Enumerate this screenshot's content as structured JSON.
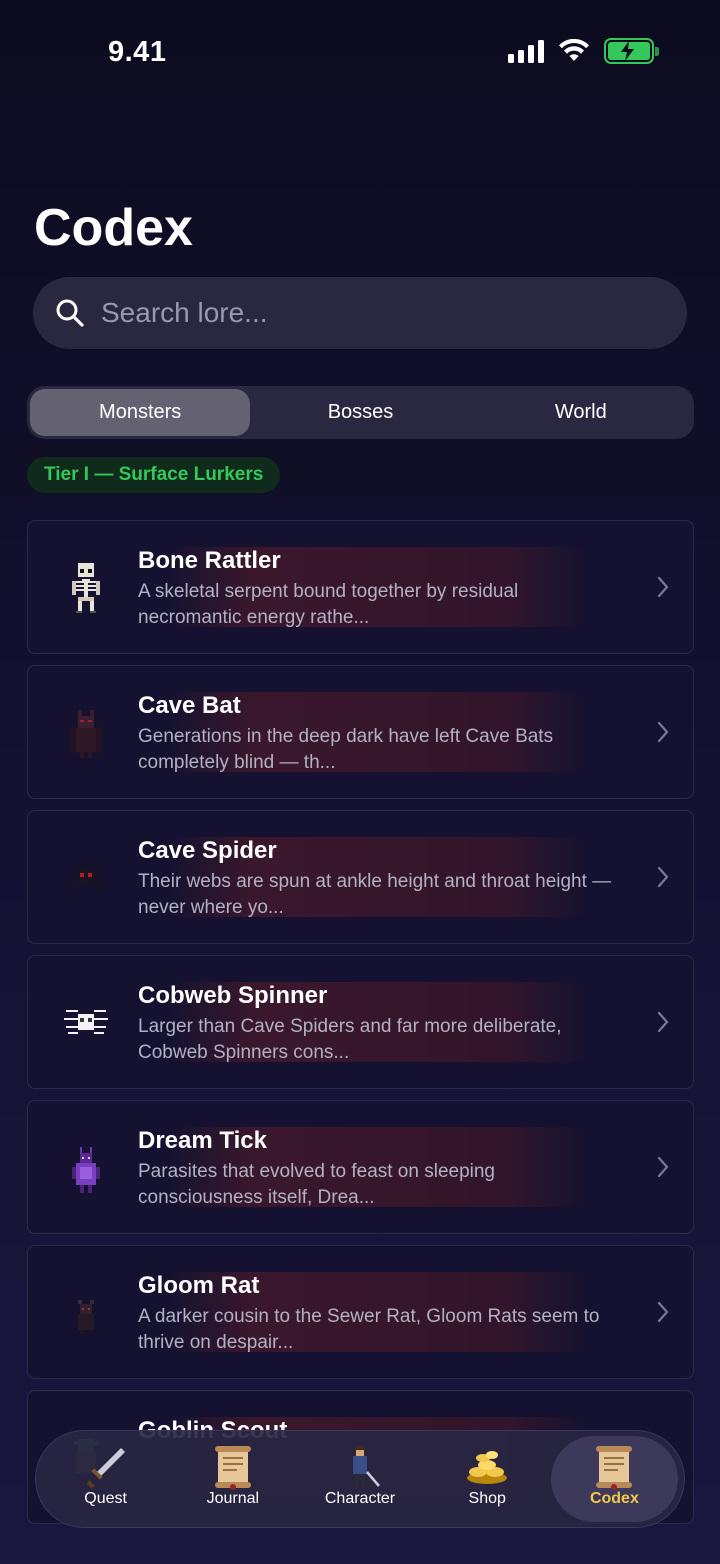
{
  "status_bar": {
    "time": "9.41"
  },
  "header": {
    "title": "Codex"
  },
  "search": {
    "placeholder": "Search lore..."
  },
  "segments": [
    {
      "label": "Monsters",
      "active": true
    },
    {
      "label": "Bosses",
      "active": false
    },
    {
      "label": "World",
      "active": false
    }
  ],
  "section": {
    "tier_label": "Tier I — Surface Lurkers"
  },
  "monsters": [
    {
      "name": "Bone Rattler",
      "description": "A skeletal serpent bound together by residual necromantic energy rathe...",
      "icon": "skeleton-icon"
    },
    {
      "name": "Cave Bat",
      "description": "Generations in the deep dark have left Cave Bats completely blind — th...",
      "icon": "bat-icon"
    },
    {
      "name": "Cave Spider",
      "description": "Their webs are spun at ankle height and throat height — never where yo...",
      "icon": "spider-icon"
    },
    {
      "name": "Cobweb Spinner",
      "description": "Larger than Cave Spiders and far more deliberate, Cobweb Spinners cons...",
      "icon": "white-spider-icon"
    },
    {
      "name": "Dream Tick",
      "description": "Parasites that evolved to feast on sleeping consciousness itself, Drea...",
      "icon": "tick-icon"
    },
    {
      "name": "Gloom Rat",
      "description": "A darker cousin to the Sewer Rat, Gloom Rats seem to thrive on despair...",
      "icon": "rat-icon"
    },
    {
      "name": "Goblin Scout",
      "description": "",
      "icon": "goblin-icon"
    }
  ],
  "tabbar": {
    "tabs": [
      {
        "label": "Quest",
        "icon": "sword-icon",
        "active": false
      },
      {
        "label": "Journal",
        "icon": "scroll-icon",
        "active": false
      },
      {
        "label": "Character",
        "icon": "character-icon",
        "active": false
      },
      {
        "label": "Shop",
        "icon": "gold-coins-icon",
        "active": false
      },
      {
        "label": "Codex",
        "icon": "scroll-icon",
        "active": true
      }
    ]
  },
  "colors": {
    "accent_green": "#34c759",
    "active_tab": "#f2c94c",
    "background": "#131130"
  }
}
